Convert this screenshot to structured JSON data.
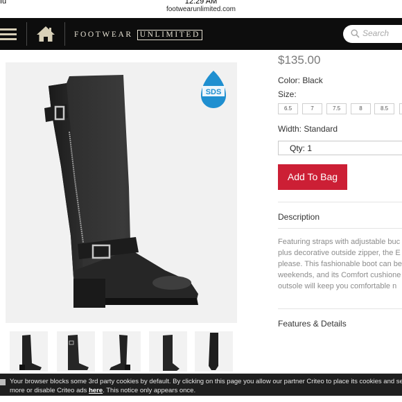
{
  "status_bar": {
    "carrier": "ıu",
    "time": "12:29 AM"
  },
  "browser": {
    "url": "footwearunlimited.com"
  },
  "header": {
    "brand_part1": "FOOTWEAR",
    "brand_part2": "UNLIMITED",
    "search_placeholder": "Search",
    "colors": {
      "background": "#0d0d0d",
      "brand_text": "#e6e1d3"
    }
  },
  "product": {
    "price": "$135.00",
    "color_label": "Color: Black",
    "size_label": "Size:",
    "sizes": [
      "6.5",
      "7",
      "7.5",
      "8",
      "8.5",
      ""
    ],
    "width_label": "Width: Standard",
    "qty_label": "Qty: 1",
    "add_to_bag_label": "Add To Bag",
    "badge_text": "SDS",
    "description_heading": "Description",
    "description_lines": [
      "Featuring straps with adjustable buc",
      "plus decorative outside zipper, the E",
      "please. This fashionable boot can be",
      "weekends, and its Comfort cushione",
      "outsole will keep you comfortable n"
    ],
    "features_heading": "Features & Details",
    "accent_color": "#cc1f35"
  },
  "gallery": {
    "thumbnails": [
      "boot-side-view",
      "boot-front-view",
      "boot-inside-view",
      "boot-angle-view",
      "boot-back-view"
    ]
  },
  "cookie_banner": {
    "line1": "Your browser blocks some 3rd party cookies by default. By clicking on this page you allow our partner Criteo to place its cookies and se",
    "line2_prefix": "more or disable Criteo ads ",
    "link_label": "here",
    "line2_suffix": ". This notice only appears once."
  }
}
